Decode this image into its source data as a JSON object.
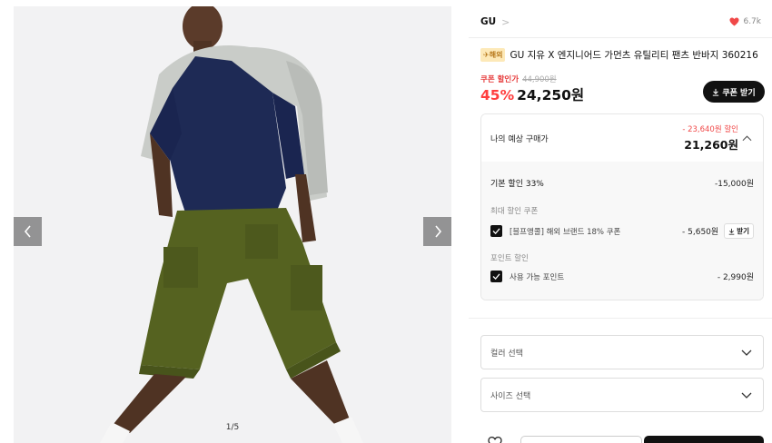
{
  "gallery": {
    "counter": "1/5",
    "prev_icon": "chevron-left-icon",
    "next_icon": "chevron-right-icon"
  },
  "product": {
    "brand": "GU",
    "brand_chevron": ">",
    "likes": "6.7k",
    "overseas_badge": "✈해외",
    "title": "GU 지유 X 엔지니어드 가먼츠 유틸리티 팬츠 반바지 360216",
    "coupon_label": "쿠폰 할인가",
    "original_price": "44,900원",
    "discount_rate": "45%",
    "sale_price": "24,250원",
    "coupon_button": "쿠폰 받기"
  },
  "estimate": {
    "label": "나의 예상 구매가",
    "discount": "- 23,640원 할인",
    "price": "21,260원",
    "basic_discount_label": "기본 할인 33%",
    "basic_discount_amount": "-15,000원",
    "max_coupon_head": "최대 할인 쿠폰",
    "coupon_item_label": "[블프앵콜] 해외 브랜드 18% 쿠폰",
    "coupon_item_amount": "- 5,650원",
    "coupon_item_button": "받기",
    "point_head": "포인트 할인",
    "point_item_label": "사용 가능 포인트",
    "point_item_amount": "- 2,990원"
  },
  "options": {
    "color_placeholder": "컬러 선택",
    "size_placeholder": "사이즈 선택"
  },
  "colors": {
    "accent_red": "#ff3d3d",
    "like_heart": "#f04848",
    "dark": "#111111"
  }
}
